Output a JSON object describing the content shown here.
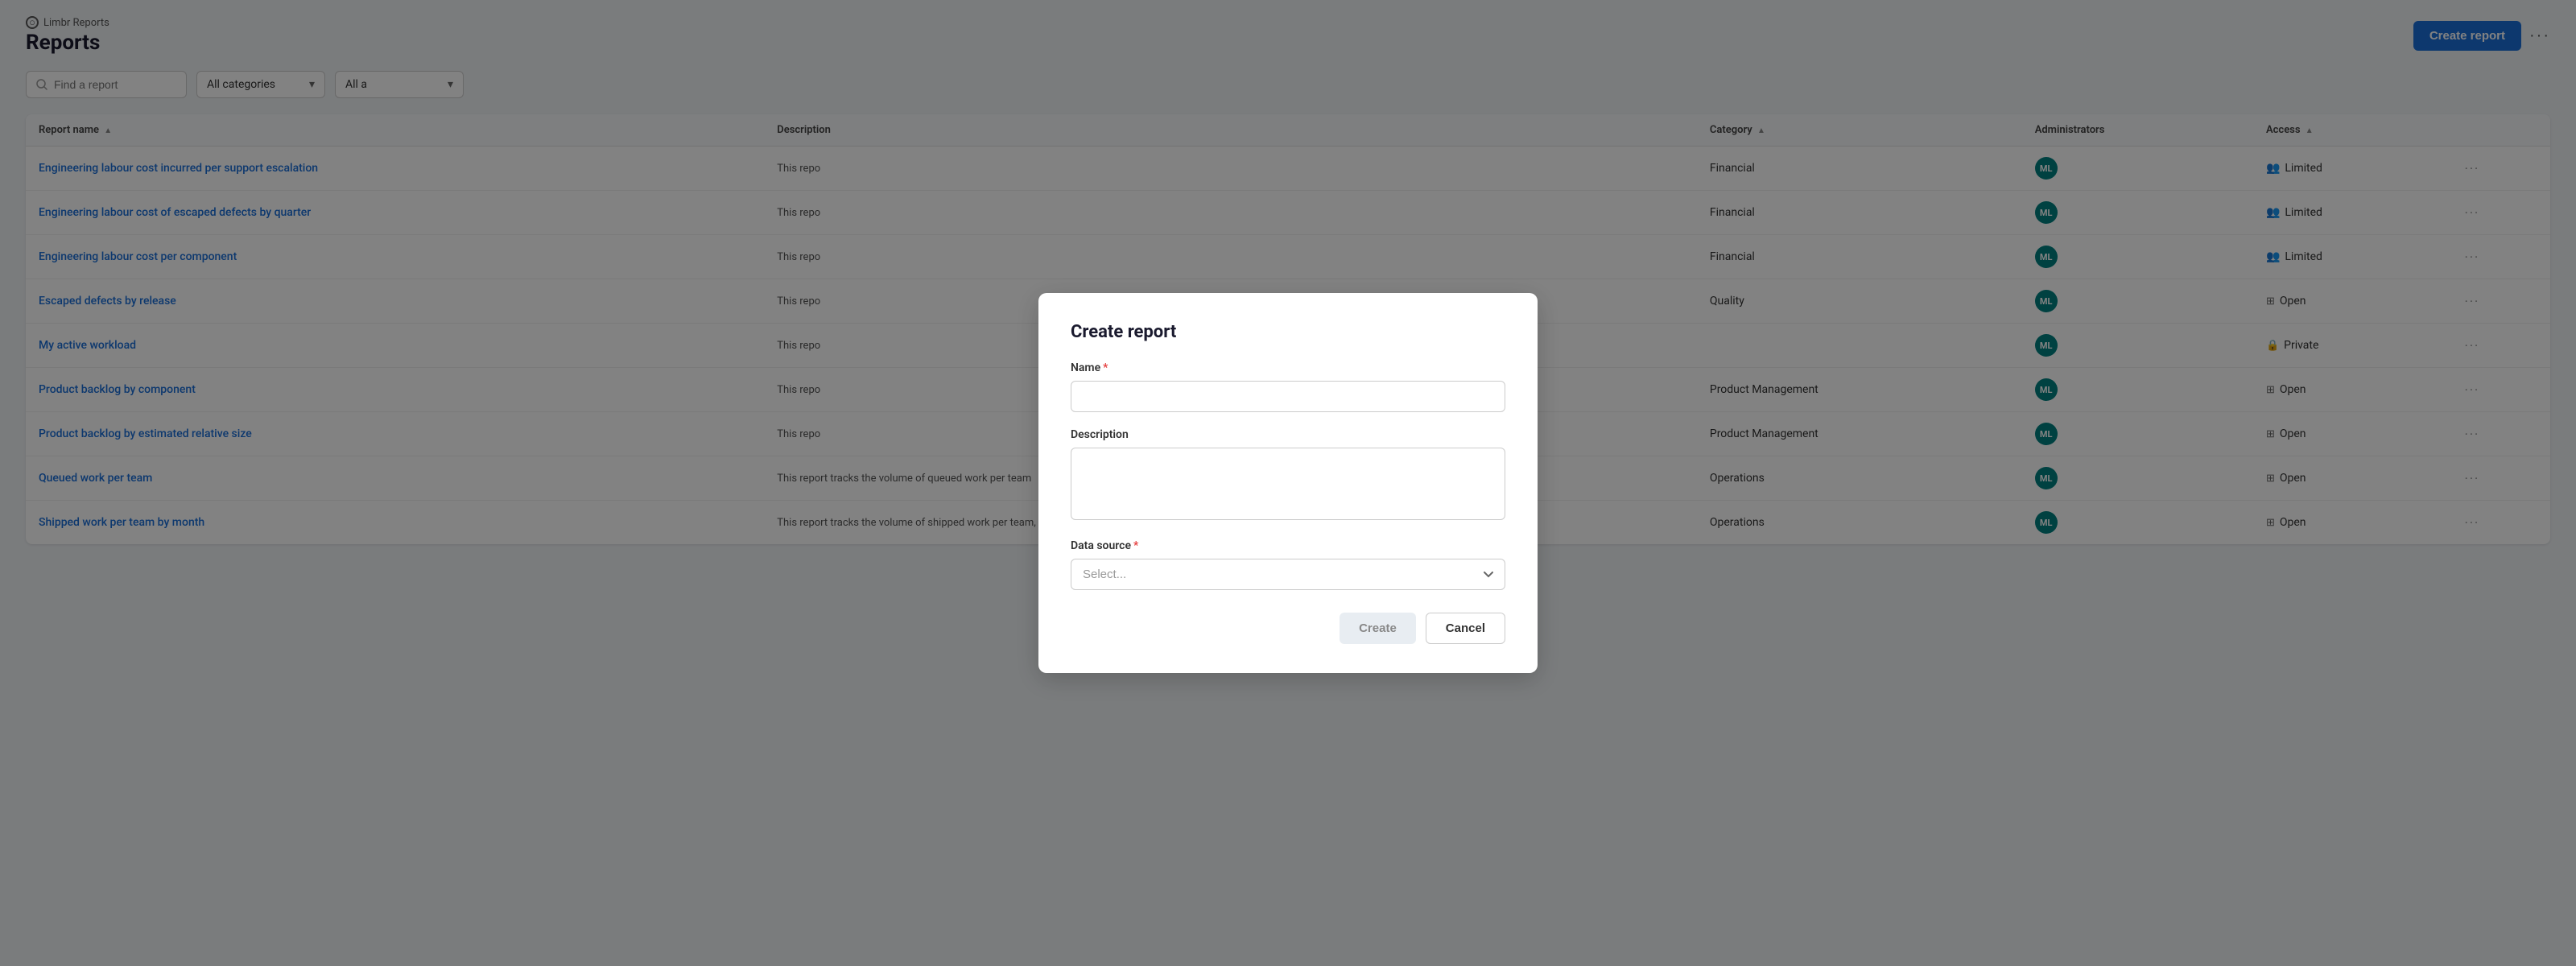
{
  "brand": {
    "name": "Limbr Reports",
    "page_title": "Reports"
  },
  "toolbar": {
    "create_report_label": "Create report",
    "more_label": "···"
  },
  "filters": {
    "search_placeholder": "Find a report",
    "category_label": "All categories",
    "category_arrow": "▾",
    "access_label": "All a",
    "access_arrow": "▾"
  },
  "table": {
    "columns": [
      {
        "key": "name",
        "label": "Report name",
        "sortable": true
      },
      {
        "key": "description",
        "label": "Description",
        "sortable": false
      },
      {
        "key": "category",
        "label": "Category",
        "sortable": true
      },
      {
        "key": "administrators",
        "label": "Administrators",
        "sortable": false
      },
      {
        "key": "access",
        "label": "Access",
        "sortable": true
      }
    ],
    "rows": [
      {
        "name": "Engineering labour cost incurred per support escalation",
        "description": "This repo",
        "category": "Financial",
        "admin_initials": "ML",
        "access": "Limited",
        "access_type": "people"
      },
      {
        "name": "Engineering labour cost of escaped defects by quarter",
        "description": "This repo",
        "category": "Financial",
        "admin_initials": "ML",
        "access": "Limited",
        "access_type": "people"
      },
      {
        "name": "Engineering labour cost per component",
        "description": "This repo",
        "category": "Financial",
        "admin_initials": "ML",
        "access": "Limited",
        "access_type": "people"
      },
      {
        "name": "Escaped defects by release",
        "description": "This repo",
        "category": "Quality",
        "admin_initials": "ML",
        "access": "Open",
        "access_type": "grid"
      },
      {
        "name": "My active workload",
        "description": "This repo",
        "category": "",
        "admin_initials": "ML",
        "access": "Private",
        "access_type": "lock"
      },
      {
        "name": "Product backlog by component",
        "description": "This repo",
        "category": "Product Management",
        "admin_initials": "ML",
        "access": "Open",
        "access_type": "grid"
      },
      {
        "name": "Product backlog by estimated relative size",
        "description": "This repo",
        "category": "Product Management",
        "admin_initials": "ML",
        "access": "Open",
        "access_type": "grid"
      },
      {
        "name": "Queued work per team",
        "description": "This report tracks the volume of queued work per team",
        "category": "Operations",
        "admin_initials": "ML",
        "access": "Open",
        "access_type": "grid"
      },
      {
        "name": "Shipped work per team by month",
        "description": "This report tracks the volume of shipped work per team, segmented by month",
        "category": "Operations",
        "admin_initials": "ML",
        "access": "Open",
        "access_type": "grid"
      }
    ]
  },
  "modal": {
    "title": "Create report",
    "name_label": "Name",
    "description_label": "Description",
    "data_source_label": "Data source",
    "data_source_placeholder": "Select...",
    "create_button": "Create",
    "cancel_button": "Cancel"
  }
}
